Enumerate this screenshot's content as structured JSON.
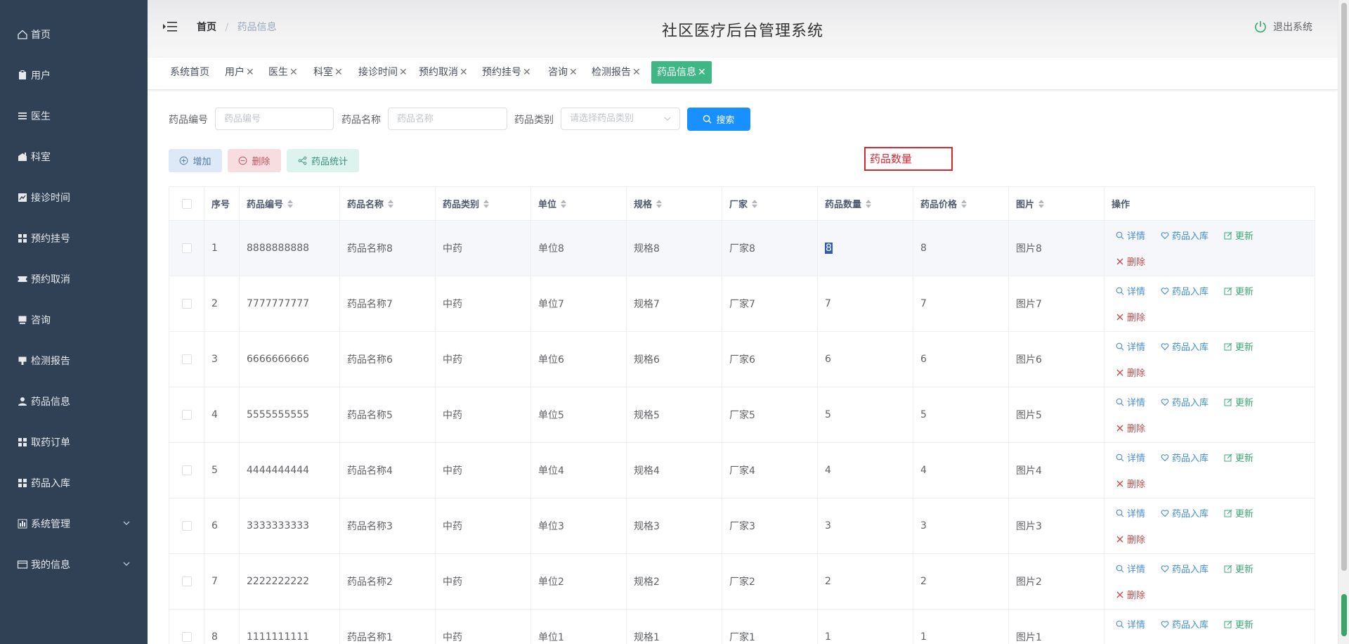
{
  "sidebar": {
    "items": [
      {
        "label": "首页",
        "icon": "home-icon"
      },
      {
        "label": "用户",
        "icon": "clipboard-icon"
      },
      {
        "label": "医生",
        "icon": "list-icon"
      },
      {
        "label": "科室",
        "icon": "house-icon"
      },
      {
        "label": "接诊时间",
        "icon": "chart-icon"
      },
      {
        "label": "预约挂号",
        "icon": "grid-icon"
      },
      {
        "label": "预约取消",
        "icon": "ticket-icon"
      },
      {
        "label": "咨询",
        "icon": "chat-icon"
      },
      {
        "label": "检测报告",
        "icon": "flag-icon"
      },
      {
        "label": "药品信息",
        "icon": "user-icon"
      },
      {
        "label": "取药订单",
        "icon": "grid-icon"
      },
      {
        "label": "药品入库",
        "icon": "grid-icon"
      },
      {
        "label": "系统管理",
        "icon": "bar-chart-icon"
      },
      {
        "label": "我的信息",
        "icon": "card-icon"
      }
    ]
  },
  "header": {
    "breadcrumb_home": "首页",
    "breadcrumb_sep": "/",
    "breadcrumb_current": "药品信息",
    "title": "社区医疗后台管理系统",
    "logout": "退出系统"
  },
  "tags": [
    {
      "label": "系统首页",
      "closable": false
    },
    {
      "label": "用户",
      "closable": true
    },
    {
      "label": "医生",
      "closable": true
    },
    {
      "label": "科室",
      "closable": true
    },
    {
      "label": "接诊时间",
      "closable": true
    },
    {
      "label": "预约取消",
      "closable": true
    },
    {
      "label": "预约挂号",
      "closable": true
    },
    {
      "label": "咨询",
      "closable": true
    },
    {
      "label": "检测报告",
      "closable": true
    },
    {
      "label": "药品信息",
      "closable": true,
      "active": true
    }
  ],
  "search": {
    "code_label": "药品编号",
    "code_placeholder": "药品编号",
    "name_label": "药品名称",
    "name_placeholder": "药品名称",
    "type_label": "药品类别",
    "type_placeholder": "请选择药品类别",
    "search_button": "搜索"
  },
  "actions": {
    "add": "增加",
    "delete": "删除",
    "stats": "药品统计"
  },
  "tooltip_box": "药品数量",
  "table": {
    "headers": [
      "序号",
      "药品编号",
      "药品名称",
      "药品类别",
      "单位",
      "规格",
      "厂家",
      "药品数量",
      "药品价格",
      "图片",
      "操作"
    ],
    "op_labels": {
      "detail": "详情",
      "stock_in": "药品入库",
      "update": "更新",
      "delete": "删除"
    },
    "rows": [
      {
        "idx": "1",
        "code": "8888888888",
        "name": "药品名称8",
        "type": "中药",
        "unit": "单位8",
        "spec": "规格8",
        "maker": "厂家8",
        "qty": "8",
        "price": "8",
        "img": "图片8"
      },
      {
        "idx": "2",
        "code": "7777777777",
        "name": "药品名称7",
        "type": "中药",
        "unit": "单位7",
        "spec": "规格7",
        "maker": "厂家7",
        "qty": "7",
        "price": "7",
        "img": "图片7"
      },
      {
        "idx": "3",
        "code": "6666666666",
        "name": "药品名称6",
        "type": "中药",
        "unit": "单位6",
        "spec": "规格6",
        "maker": "厂家6",
        "qty": "6",
        "price": "6",
        "img": "图片6"
      },
      {
        "idx": "4",
        "code": "5555555555",
        "name": "药品名称5",
        "type": "中药",
        "unit": "单位5",
        "spec": "规格5",
        "maker": "厂家5",
        "qty": "5",
        "price": "5",
        "img": "图片5"
      },
      {
        "idx": "5",
        "code": "4444444444",
        "name": "药品名称4",
        "type": "中药",
        "unit": "单位4",
        "spec": "规格4",
        "maker": "厂家4",
        "qty": "4",
        "price": "4",
        "img": "图片4"
      },
      {
        "idx": "6",
        "code": "3333333333",
        "name": "药品名称3",
        "type": "中药",
        "unit": "单位3",
        "spec": "规格3",
        "maker": "厂家3",
        "qty": "3",
        "price": "3",
        "img": "图片3"
      },
      {
        "idx": "7",
        "code": "2222222222",
        "name": "药品名称2",
        "type": "中药",
        "unit": "单位2",
        "spec": "规格2",
        "maker": "厂家2",
        "qty": "2",
        "price": "2",
        "img": "图片2"
      },
      {
        "idx": "8",
        "code": "1111111111",
        "name": "药品名称1",
        "type": "中药",
        "unit": "单位1",
        "spec": "规格1",
        "maker": "厂家1",
        "qty": "1",
        "price": "1",
        "img": "图片1"
      }
    ]
  },
  "colors": {
    "sidebar_bg": "#304156",
    "active_tag": "#3eb787",
    "primary": "#1890ff",
    "highlight_border": "#d9252f"
  }
}
